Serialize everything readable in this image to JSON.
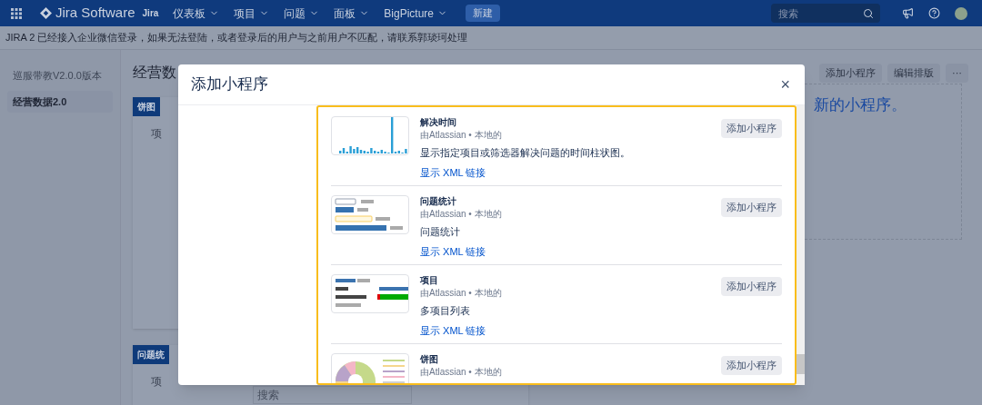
{
  "nav": {
    "app_name": "Jira Software",
    "product": "Jira",
    "menus": [
      {
        "label": "仪表板"
      },
      {
        "label": "项目"
      },
      {
        "label": "问题"
      },
      {
        "label": "面板"
      },
      {
        "label": "BigPicture"
      }
    ],
    "create": "新建",
    "search_placeholder": "搜索"
  },
  "banner": "JIRA 2 已经接入企业微信登录，如果无法登陆，或者登录后的用户与之前用户不匹配，请联系郭琰珂处理",
  "sidebar": {
    "items": [
      {
        "label": "巡服带教V2.0.0版本",
        "selected": false
      },
      {
        "label": "经营数据2.0",
        "selected": true
      }
    ]
  },
  "page": {
    "title": "经营数",
    "buttons": [
      "添加小程序",
      "编辑排版",
      "···"
    ],
    "drop_hint": "新的小程序。",
    "panels": [
      {
        "title": "饼图",
        "field_label": "项"
      },
      {
        "title": "问题统",
        "field_label": "项",
        "search_placeholder": "搜索"
      }
    ]
  },
  "dialog": {
    "title": "添加小程序",
    "close": "×",
    "gadgets": [
      {
        "kind": "bar_chart",
        "name": "解决时间",
        "meta": "由Atlassian • 本地的",
        "description": "显示指定项目或筛选器解决问题的时间柱状图。",
        "link": "显示 XML 链接",
        "button": "添加小程序"
      },
      {
        "kind": "issue_stats",
        "name": "问题统计",
        "meta": "由Atlassian • 本地的",
        "description": "问题统计",
        "link": "显示 XML 链接",
        "button": "添加小程序"
      },
      {
        "kind": "project",
        "name": "项目",
        "meta": "由Atlassian • 本地的",
        "description": "多项目列表",
        "link": "显示 XML 链接",
        "button": "添加小程序"
      },
      {
        "kind": "pie",
        "name": "饼图",
        "meta": "由Atlassian • 本地的",
        "button": "添加小程序"
      }
    ]
  }
}
